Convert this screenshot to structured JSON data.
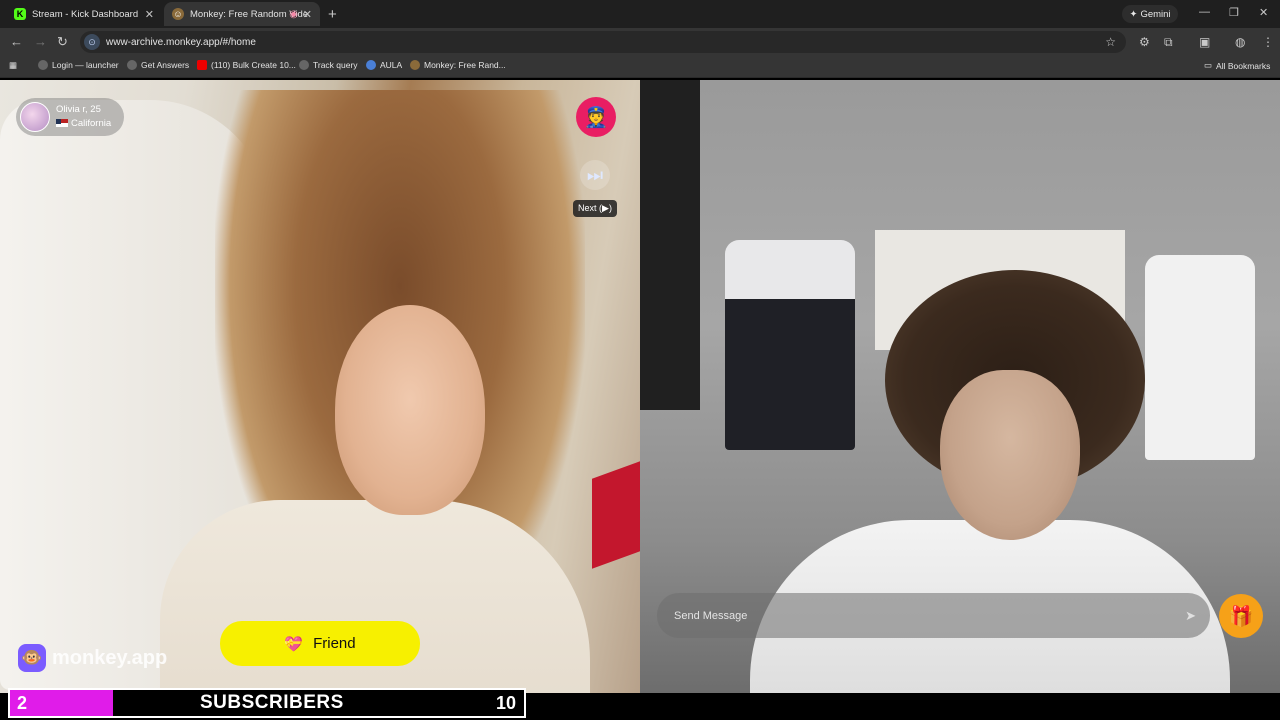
{
  "browser": {
    "tabs": [
      {
        "title": "Stream - Kick Dashboard",
        "active": false
      },
      {
        "title": "Monkey: Free Random Vide",
        "active": true
      }
    ],
    "gemini_label": "Gemini",
    "url": "www-archive.monkey.app/#/home",
    "bookmarks": [
      "Login — launcher",
      "Get Answers",
      "(110) Bulk Create 10...",
      "Track query",
      "AULA",
      "Monkey: Free Rand..."
    ],
    "all_bookmarks": "All Bookmarks"
  },
  "call": {
    "partner_name": "Olivia r, 25",
    "partner_location": "California",
    "next_tooltip": "Next (▶)",
    "friend_label": "Friend",
    "brand_name": "monkey.app",
    "message_placeholder": "Send Message"
  },
  "subscriber_goal": {
    "current": "2",
    "label": "SUBSCRIBERS",
    "goal": "10",
    "progress_fraction": 0.2,
    "fill_color": "#e01ce9"
  },
  "icons": [
    "police-icon",
    "next-icon",
    "gift-icon",
    "heart-icon",
    "send-icon",
    "monkey-logo-icon"
  ]
}
